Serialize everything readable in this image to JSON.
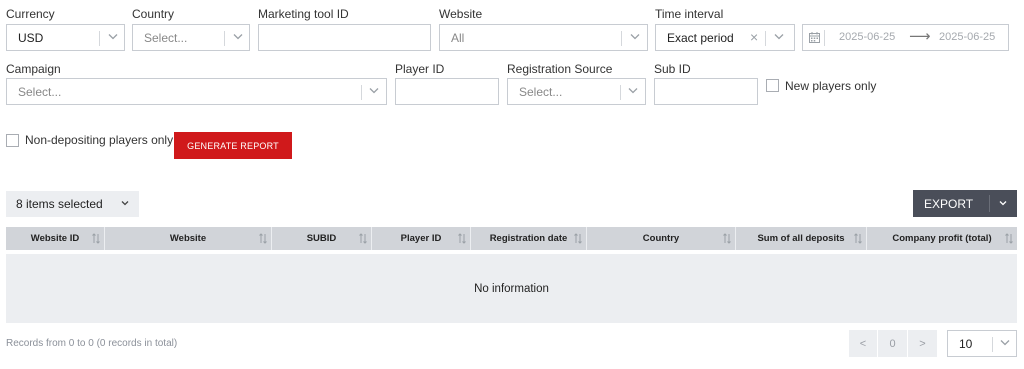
{
  "filters": {
    "currency": {
      "label": "Currency",
      "value": "USD"
    },
    "country": {
      "label": "Country",
      "placeholder": "Select..."
    },
    "marketing_tool_id": {
      "label": "Marketing tool ID",
      "value": ""
    },
    "website": {
      "label": "Website",
      "value": "All"
    },
    "time_interval": {
      "label": "Time interval",
      "value": "Exact period",
      "clear": "×",
      "date_from": "2025-06-25",
      "date_to": "2025-06-25",
      "arrow": "⟶"
    },
    "campaign": {
      "label": "Campaign",
      "placeholder": "Select..."
    },
    "player_id": {
      "label": "Player ID",
      "value": ""
    },
    "registration_source": {
      "label": "Registration Source",
      "placeholder": "Select..."
    },
    "sub_id": {
      "label": "Sub ID",
      "value": ""
    },
    "new_players_only": {
      "label": "New players only",
      "checked": false
    },
    "non_depositing_only": {
      "label": "Non-depositing players only",
      "checked": false
    }
  },
  "actions": {
    "generate_report": "GENERATE REPORT",
    "columns_selected": "8 items selected",
    "export": "EXPORT"
  },
  "table": {
    "columns": [
      "Website ID",
      "Website",
      "SUBID",
      "Player ID",
      "Registration date",
      "Country",
      "Sum of all deposits",
      "Company profit (total)"
    ],
    "empty_text": "No information"
  },
  "footer": {
    "records": "Records from 0 to 0 (0 records in total)",
    "prev": "<",
    "page": "0",
    "next": ">",
    "page_size": "10"
  },
  "colors": {
    "accent_red": "#d0191b",
    "export_dark": "#4a4e59",
    "header_gray": "#d1d4d9",
    "row_gray": "#eceef1"
  }
}
